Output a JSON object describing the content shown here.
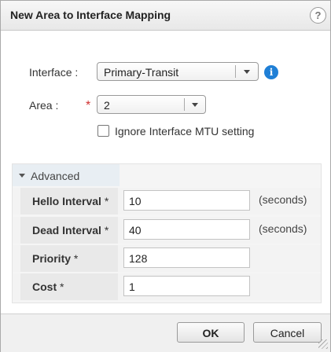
{
  "dialog": {
    "title": "New Area to Interface Mapping",
    "help": "?"
  },
  "form": {
    "interface_label": "Interface :",
    "interface_value": "Primary-Transit",
    "info": "i",
    "area_label": "Area :",
    "required_marker": "*",
    "area_value": "2",
    "ignore_mtu_label": "Ignore Interface MTU setting",
    "ignore_mtu_checked": false
  },
  "advanced": {
    "header": "Advanced",
    "fields": [
      {
        "label": "Hello Interval",
        "required": "*",
        "value": "10",
        "unit": "(seconds)"
      },
      {
        "label": "Dead Interval",
        "required": "*",
        "value": "40",
        "unit": "(seconds)"
      },
      {
        "label": "Priority",
        "required": "*",
        "value": "128",
        "unit": ""
      },
      {
        "label": "Cost",
        "required": "*",
        "value": "1",
        "unit": ""
      }
    ]
  },
  "footer": {
    "ok_label": "OK",
    "cancel_label": "Cancel"
  },
  "colors": {
    "info_blue": "#1f7fd6",
    "required_red": "#d03030"
  }
}
